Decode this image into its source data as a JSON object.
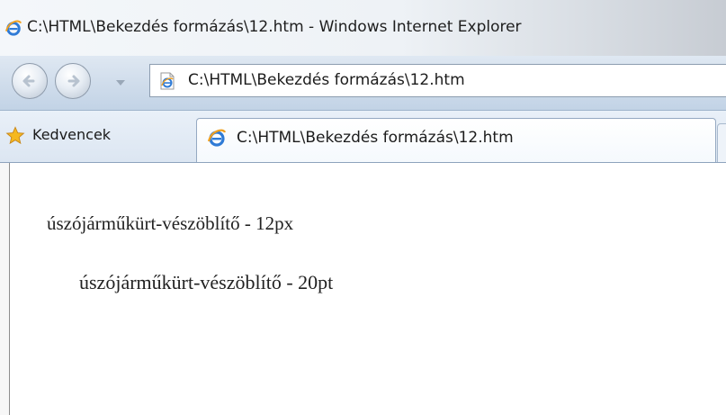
{
  "window": {
    "title": "C:\\HTML\\Bekezdés formázás\\12.htm - Windows Internet Explorer",
    "icon": "ie-icon"
  },
  "navigation": {
    "back_icon": "back-arrow-icon",
    "forward_icon": "forward-arrow-icon",
    "recent_pages_icon": "chevron-down-icon"
  },
  "address_bar": {
    "icon": "page-icon",
    "url": "C:\\HTML\\Bekezdés formázás\\12.htm"
  },
  "favorites_bar": {
    "favorites_label": "Kedvencek",
    "favorites_icon": "star-icon"
  },
  "tabs": [
    {
      "label": "C:\\HTML\\Bekezdés formázás\\12.htm",
      "icon": "ie-icon",
      "active": true
    }
  ],
  "page": {
    "paragraphs": [
      {
        "text": "úszójárműkürt-vészöblítő - 12px"
      },
      {
        "text": "úszójárműkürt-vészöblítő - 20pt"
      }
    ]
  },
  "colors": {
    "ie_blue": "#2f7bd6",
    "ie_orange": "#f0a020",
    "star_gold": "#f5b820"
  }
}
